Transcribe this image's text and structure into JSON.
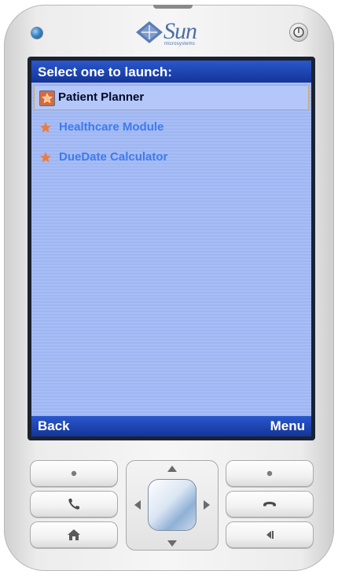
{
  "device": {
    "brand": "Sun",
    "brand_sub": "microsystems"
  },
  "screen": {
    "title": "Select one to launch:",
    "items": [
      {
        "label": "Patient Planner",
        "selected": true
      },
      {
        "label": "Healthcare Module",
        "selected": false
      },
      {
        "label": "DueDate Calculator",
        "selected": false
      }
    ],
    "softkeys": {
      "left": "Back",
      "right": "Menu"
    }
  },
  "colors": {
    "screen_bg": "#a7bdf6",
    "bar_blue": "#1d44b0",
    "item_text": "#3e7bea",
    "selected_text": "#00092a",
    "star_orange": "#f07b3a"
  }
}
